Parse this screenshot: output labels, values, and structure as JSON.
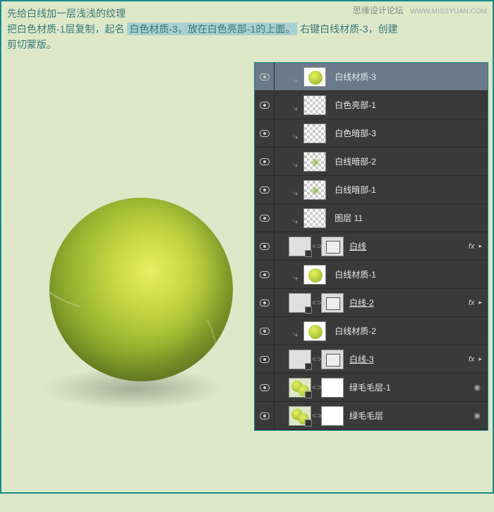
{
  "watermark": {
    "main": "思缘设计论坛",
    "sub": "WWW.MISSYUAN.COM"
  },
  "instructions": {
    "line1": "先给白线加一层浅浅的纹理",
    "line2_before": "把白色材质-1层复制，起名 ",
    "line2_hl": "白色材质-3，放在白色亮部-1的上面。",
    "line2_after": " 右键白线材质-3，创建",
    "line3": "剪切蒙版。"
  },
  "layers": [
    {
      "name": "白线材质-3",
      "selected": true,
      "clipped": true,
      "thumb": "ball"
    },
    {
      "name": "白色亮部-1",
      "clipped": true,
      "thumb": "checker"
    },
    {
      "name": "白色暗部-3",
      "clipped": true,
      "thumb": "checker"
    },
    {
      "name": "白线暗部-2",
      "clipped": true,
      "thumb": "glow"
    },
    {
      "name": "白线暗部-1",
      "clipped": true,
      "thumb": "glow"
    },
    {
      "name": "图层 11",
      "clipped": true,
      "thumb": "checker"
    },
    {
      "name": "白线",
      "underline": true,
      "thumb": "smartpath",
      "mask": true,
      "fx": true
    },
    {
      "name": "白线材质-1",
      "clipped": true,
      "thumb": "ball"
    },
    {
      "name": "白线-2",
      "underline": true,
      "thumb": "smartpath",
      "mask": true,
      "fx": true
    },
    {
      "name": "白线材质-2",
      "clipped": true,
      "thumb": "ball"
    },
    {
      "name": "白线-3",
      "underline": true,
      "thumb": "smartpath",
      "mask": true,
      "fx": true
    },
    {
      "name": "绿毛毛层-1",
      "thumb": "doubleball",
      "mask": true,
      "locked": true
    },
    {
      "name": "绿毛毛层",
      "thumb": "doubleball",
      "mask": true,
      "locked": true
    }
  ]
}
